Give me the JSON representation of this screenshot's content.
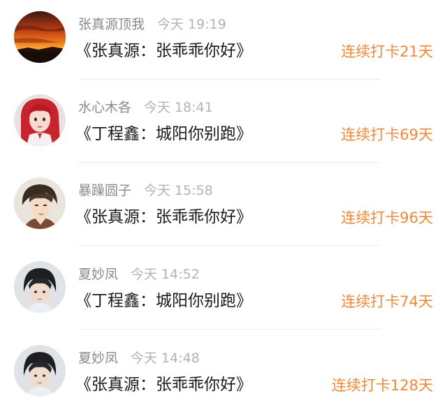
{
  "feed": {
    "items": [
      {
        "user": "张真源顶我",
        "time": "今天 19:19",
        "content": "《张真源：张乖乖你好》",
        "streak": "连续打卡21天",
        "avatar": "sunset-avatar"
      },
      {
        "user": "水心木各",
        "time": "今天 18:41",
        "content": "《丁程鑫：城阳你别跑》",
        "streak": "连续打卡69天",
        "avatar": "red-hair-girl-avatar"
      },
      {
        "user": "暴躁圆子",
        "time": "今天 15:58",
        "content": "《张真源：张乖乖你好》",
        "streak": "连续打卡96天",
        "avatar": "anime-boy-avatar"
      },
      {
        "user": "夏妙凤",
        "time": "今天 14:52",
        "content": "《丁程鑫：城阳你别跑》",
        "streak": "连续打卡74天",
        "avatar": "boy-portrait-avatar"
      },
      {
        "user": "夏妙凤",
        "time": "今天 14:48",
        "content": "《张真源：张乖乖你好》",
        "streak": "连续打卡128天",
        "avatar": "boy-portrait-avatar"
      }
    ],
    "colors": {
      "streak": "#f0883a",
      "username": "#8a8a8a",
      "time": "#b2b2b2",
      "content": "#1a1a1a"
    }
  }
}
